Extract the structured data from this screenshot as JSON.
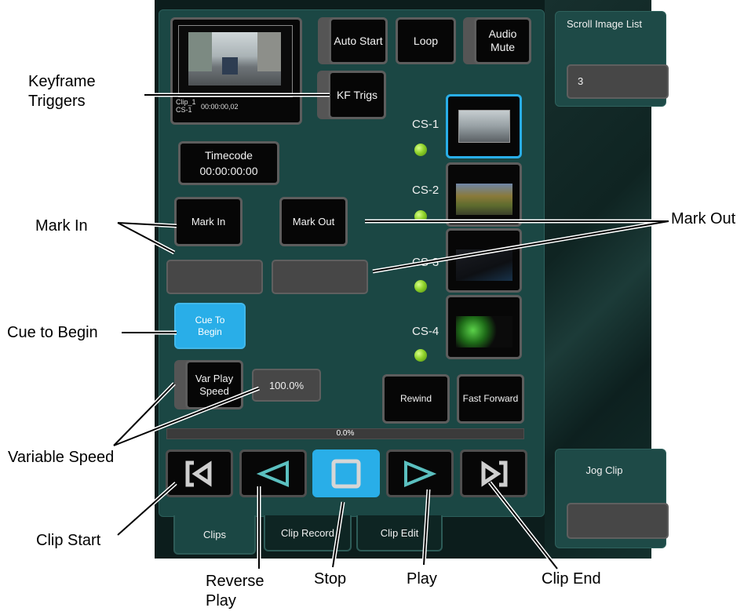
{
  "panel": {
    "clip_name": "Clip_1",
    "clip_cs": "CS-1",
    "clip_timecode": "00:00:00,02",
    "buttons": {
      "auto_start": "Auto Start",
      "loop": "Loop",
      "audio_mute": "Audio Mute",
      "kf_trigs": "KF Trigs",
      "timecode_label": "Timecode",
      "timecode_value": "00:00:00:00",
      "mark_in": "Mark In",
      "mark_out": "Mark Out",
      "cue_to_begin": "Cue To Begin",
      "var_play_speed": "Var Play Speed",
      "rewind": "Rewind",
      "fast_forward": "Fast Forward"
    },
    "var_speed_value": "100.0%",
    "progress": {
      "text": "0.0%",
      "fraction": 0.0
    },
    "channels": [
      {
        "label": "CS-1",
        "selected": true
      },
      {
        "label": "CS-2",
        "selected": false
      },
      {
        "label": "CS-3",
        "selected": false
      },
      {
        "label": "CS-4",
        "selected": false
      }
    ],
    "transport": [
      {
        "name": "clip-start",
        "icon": "clip-start-icon",
        "active": false
      },
      {
        "name": "reverse-play",
        "icon": "reverse-play-icon",
        "active": false
      },
      {
        "name": "stop",
        "icon": "stop-icon",
        "active": true
      },
      {
        "name": "play",
        "icon": "play-icon",
        "active": false
      },
      {
        "name": "clip-end",
        "icon": "clip-end-icon",
        "active": false
      }
    ],
    "tabs": [
      "Clips",
      "Clip Record",
      "Clip Edit"
    ],
    "active_tab": "Clips"
  },
  "side": {
    "scroll_label": "Scroll Image List",
    "scroll_value": "3",
    "jog_label": "Jog Clip",
    "jog_value": ""
  },
  "callouts": {
    "keyframe_triggers": "Keyframe Triggers",
    "mark_in": "Mark In",
    "mark_out": "Mark Out",
    "cue_to_begin": "Cue to Begin",
    "variable_speed": "Variable Speed",
    "clip_start": "Clip Start",
    "reverse_play": "Reverse Play",
    "stop": "Stop",
    "play": "Play",
    "clip_end": "Clip End"
  },
  "colors": {
    "panel": "#1b4744",
    "accent_blue": "#29aee8",
    "led_green": "#8fd22a",
    "button": "#060606"
  }
}
